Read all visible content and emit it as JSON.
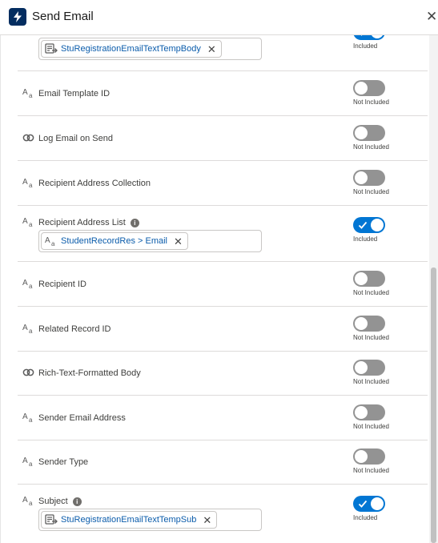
{
  "header": {
    "title": "Send Email",
    "close_glyph": "✕",
    "app_icon": "lightning-icon"
  },
  "fields": [
    {
      "label": "",
      "icon": "template-icon",
      "info": false,
      "pill": {
        "text": "StuRegistrationEmailTextTempBody",
        "icon": "template-icon"
      },
      "included": true,
      "status": "Included"
    },
    {
      "label": "Email Template ID",
      "icon": "text-type-icon",
      "info": false,
      "pill": null,
      "included": false,
      "status": "Not Included"
    },
    {
      "label": "Log Email on Send",
      "icon": "boolean-type-icon",
      "info": false,
      "pill": null,
      "included": false,
      "status": "Not Included"
    },
    {
      "label": "Recipient Address Collection",
      "icon": "text-type-icon",
      "info": false,
      "pill": null,
      "included": false,
      "status": "Not Included"
    },
    {
      "label": "Recipient Address List",
      "icon": "text-type-icon",
      "info": true,
      "pill": {
        "text": "StudentRecordRes > Email",
        "icon": "text-type-icon"
      },
      "included": true,
      "status": "Included"
    },
    {
      "label": "Recipient ID",
      "icon": "text-type-icon",
      "info": false,
      "pill": null,
      "included": false,
      "status": "Not Included"
    },
    {
      "label": "Related Record ID",
      "icon": "text-type-icon",
      "info": false,
      "pill": null,
      "included": false,
      "status": "Not Included"
    },
    {
      "label": "Rich-Text-Formatted Body",
      "icon": "boolean-type-icon",
      "info": false,
      "pill": null,
      "included": false,
      "status": "Not Included"
    },
    {
      "label": "Sender Email Address",
      "icon": "text-type-icon",
      "info": false,
      "pill": null,
      "included": false,
      "status": "Not Included"
    },
    {
      "label": "Sender Type",
      "icon": "text-type-icon",
      "info": false,
      "pill": null,
      "included": false,
      "status": "Not Included"
    },
    {
      "label": "Subject",
      "icon": "text-type-icon",
      "info": true,
      "pill": {
        "text": "StuRegistrationEmailTextTempSub",
        "icon": "template-icon"
      },
      "included": true,
      "status": "Included"
    }
  ],
  "info_glyph": "i",
  "colors": {
    "toggle_on": "#0176d3",
    "toggle_off": "#939393",
    "pill_text": "#0b5cab",
    "header_icon_bg": "#032d60"
  }
}
